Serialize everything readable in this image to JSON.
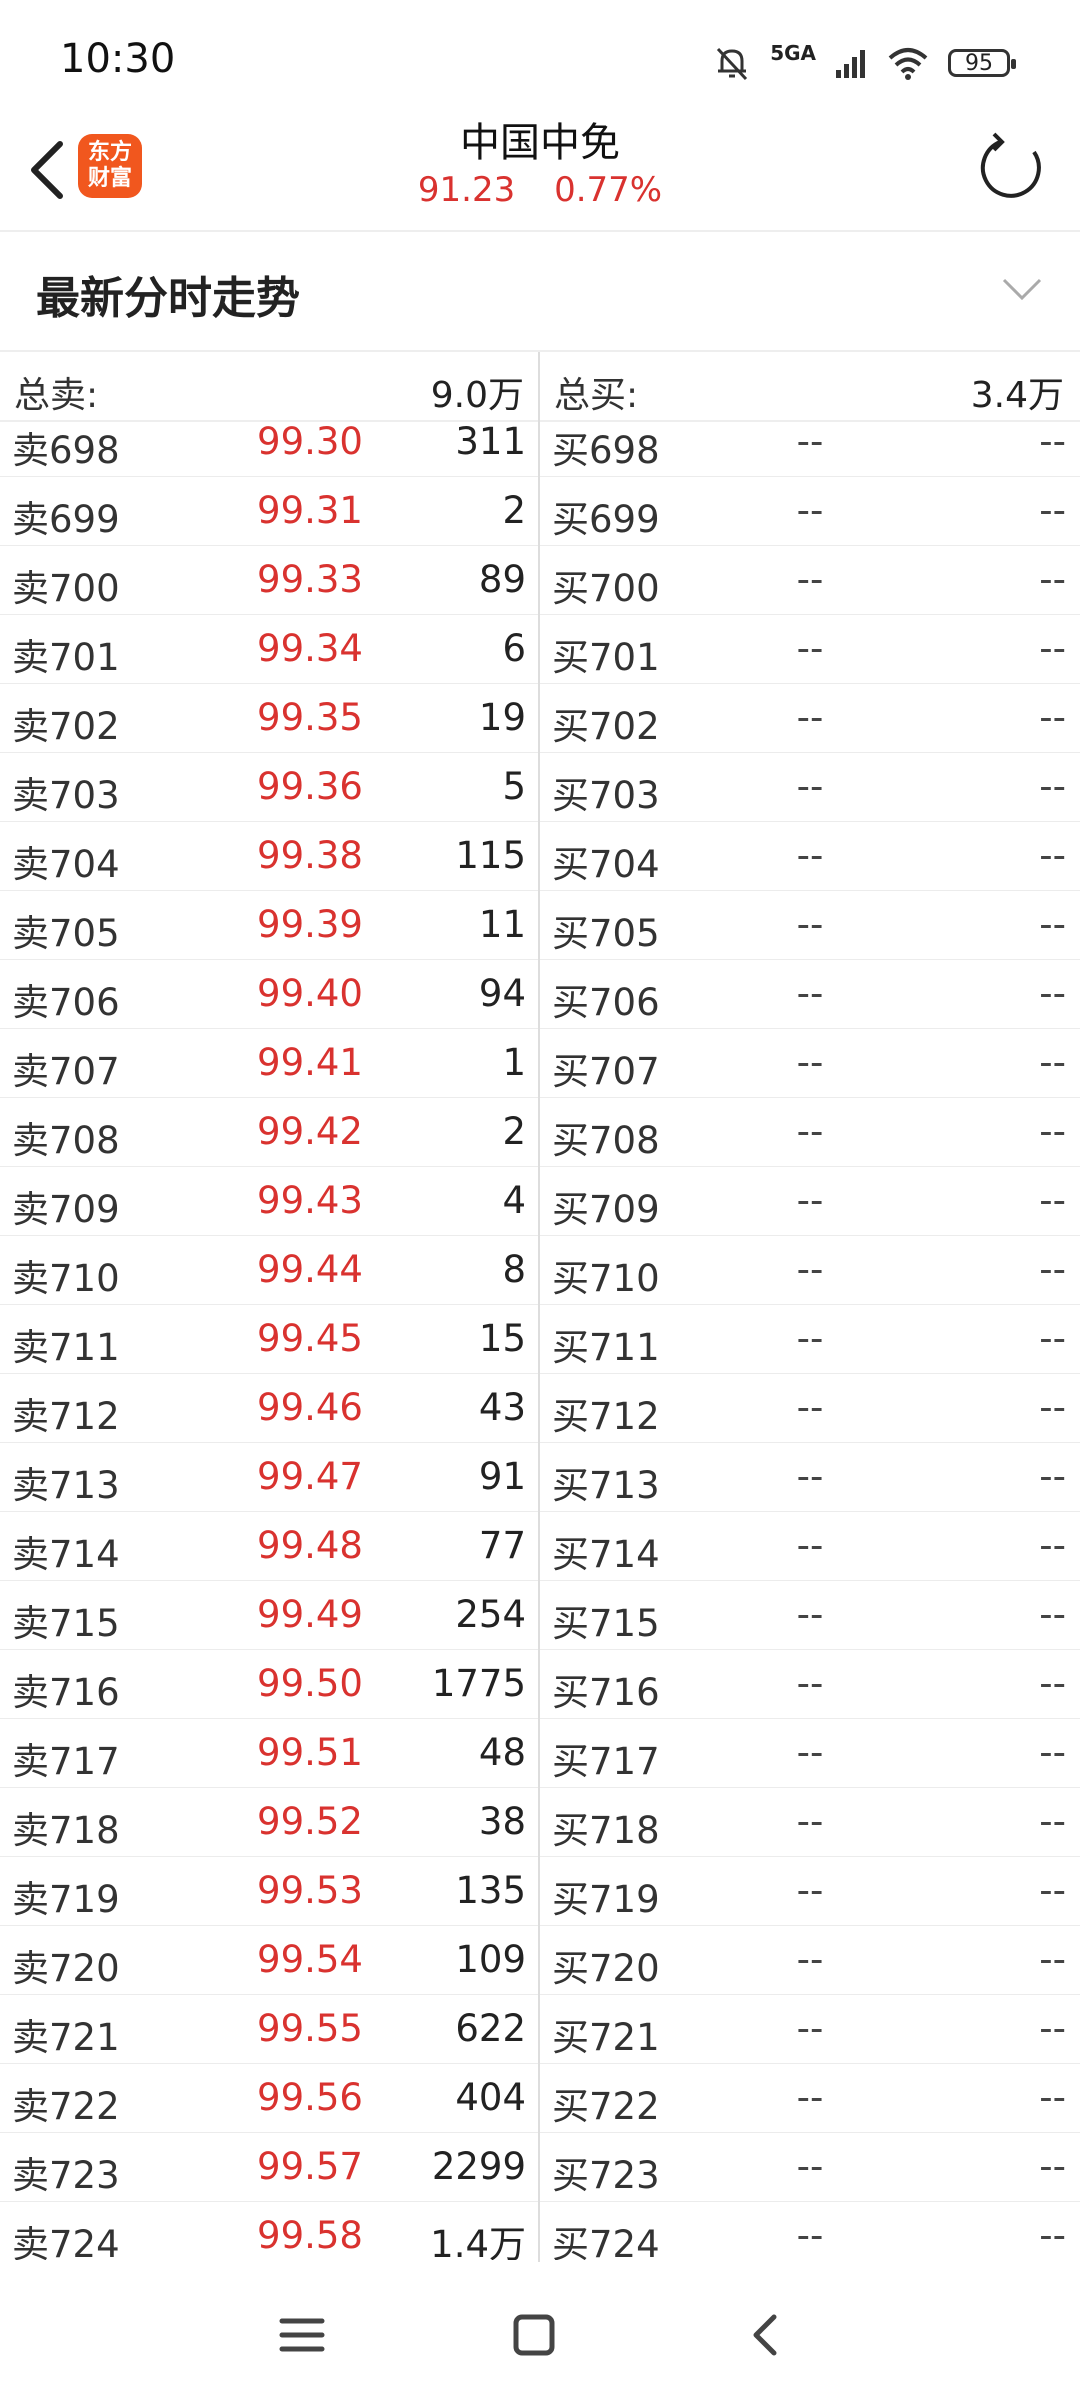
{
  "status_bar": {
    "time": "10:30",
    "network": "5GA",
    "battery": "95",
    "icons": [
      "bell-muted-icon",
      "signal-icon",
      "wifi-icon",
      "battery-icon"
    ]
  },
  "header": {
    "logo_line1": "东方",
    "logo_line2": "财富",
    "stock_name": "中国中免",
    "price": "91.23",
    "change": "0.77%"
  },
  "section": {
    "title": "最新分时走势"
  },
  "totals": {
    "sell_label": "总卖:",
    "sell_value": "9.0万",
    "buy_label": "总买:",
    "buy_value": "3.4万"
  },
  "orderbook": {
    "rows": [
      {
        "sell_label": "卖698",
        "sell_price": "99.30",
        "sell_vol": "311",
        "buy_label": "买698",
        "buy_price": "--",
        "buy_vol": "--"
      },
      {
        "sell_label": "卖699",
        "sell_price": "99.31",
        "sell_vol": "2",
        "buy_label": "买699",
        "buy_price": "--",
        "buy_vol": "--"
      },
      {
        "sell_label": "卖700",
        "sell_price": "99.33",
        "sell_vol": "89",
        "buy_label": "买700",
        "buy_price": "--",
        "buy_vol": "--"
      },
      {
        "sell_label": "卖701",
        "sell_price": "99.34",
        "sell_vol": "6",
        "buy_label": "买701",
        "buy_price": "--",
        "buy_vol": "--"
      },
      {
        "sell_label": "卖702",
        "sell_price": "99.35",
        "sell_vol": "19",
        "buy_label": "买702",
        "buy_price": "--",
        "buy_vol": "--"
      },
      {
        "sell_label": "卖703",
        "sell_price": "99.36",
        "sell_vol": "5",
        "buy_label": "买703",
        "buy_price": "--",
        "buy_vol": "--"
      },
      {
        "sell_label": "卖704",
        "sell_price": "99.38",
        "sell_vol": "115",
        "buy_label": "买704",
        "buy_price": "--",
        "buy_vol": "--"
      },
      {
        "sell_label": "卖705",
        "sell_price": "99.39",
        "sell_vol": "11",
        "buy_label": "买705",
        "buy_price": "--",
        "buy_vol": "--"
      },
      {
        "sell_label": "卖706",
        "sell_price": "99.40",
        "sell_vol": "94",
        "buy_label": "买706",
        "buy_price": "--",
        "buy_vol": "--"
      },
      {
        "sell_label": "卖707",
        "sell_price": "99.41",
        "sell_vol": "1",
        "buy_label": "买707",
        "buy_price": "--",
        "buy_vol": "--"
      },
      {
        "sell_label": "卖708",
        "sell_price": "99.42",
        "sell_vol": "2",
        "buy_label": "买708",
        "buy_price": "--",
        "buy_vol": "--"
      },
      {
        "sell_label": "卖709",
        "sell_price": "99.43",
        "sell_vol": "4",
        "buy_label": "买709",
        "buy_price": "--",
        "buy_vol": "--"
      },
      {
        "sell_label": "卖710",
        "sell_price": "99.44",
        "sell_vol": "8",
        "buy_label": "买710",
        "buy_price": "--",
        "buy_vol": "--"
      },
      {
        "sell_label": "卖711",
        "sell_price": "99.45",
        "sell_vol": "15",
        "buy_label": "买711",
        "buy_price": "--",
        "buy_vol": "--"
      },
      {
        "sell_label": "卖712",
        "sell_price": "99.46",
        "sell_vol": "43",
        "buy_label": "买712",
        "buy_price": "--",
        "buy_vol": "--"
      },
      {
        "sell_label": "卖713",
        "sell_price": "99.47",
        "sell_vol": "91",
        "buy_label": "买713",
        "buy_price": "--",
        "buy_vol": "--"
      },
      {
        "sell_label": "卖714",
        "sell_price": "99.48",
        "sell_vol": "77",
        "buy_label": "买714",
        "buy_price": "--",
        "buy_vol": "--"
      },
      {
        "sell_label": "卖715",
        "sell_price": "99.49",
        "sell_vol": "254",
        "buy_label": "买715",
        "buy_price": "--",
        "buy_vol": "--"
      },
      {
        "sell_label": "卖716",
        "sell_price": "99.50",
        "sell_vol": "1775",
        "buy_label": "买716",
        "buy_price": "--",
        "buy_vol": "--"
      },
      {
        "sell_label": "卖717",
        "sell_price": "99.51",
        "sell_vol": "48",
        "buy_label": "买717",
        "buy_price": "--",
        "buy_vol": "--"
      },
      {
        "sell_label": "卖718",
        "sell_price": "99.52",
        "sell_vol": "38",
        "buy_label": "买718",
        "buy_price": "--",
        "buy_vol": "--"
      },
      {
        "sell_label": "卖719",
        "sell_price": "99.53",
        "sell_vol": "135",
        "buy_label": "买719",
        "buy_price": "--",
        "buy_vol": "--"
      },
      {
        "sell_label": "卖720",
        "sell_price": "99.54",
        "sell_vol": "109",
        "buy_label": "买720",
        "buy_price": "--",
        "buy_vol": "--"
      },
      {
        "sell_label": "卖721",
        "sell_price": "99.55",
        "sell_vol": "622",
        "buy_label": "买721",
        "buy_price": "--",
        "buy_vol": "--"
      },
      {
        "sell_label": "卖722",
        "sell_price": "99.56",
        "sell_vol": "404",
        "buy_label": "买722",
        "buy_price": "--",
        "buy_vol": "--"
      },
      {
        "sell_label": "卖723",
        "sell_price": "99.57",
        "sell_vol": "2299",
        "buy_label": "买723",
        "buy_price": "--",
        "buy_vol": "--"
      },
      {
        "sell_label": "卖724",
        "sell_price": "99.58",
        "sell_vol": "1.4万",
        "buy_label": "买724",
        "buy_price": "--",
        "buy_vol": "--"
      }
    ]
  },
  "nav_bar": {
    "icons": [
      "menu-icon",
      "home-square-icon",
      "back-chevron-icon"
    ]
  },
  "colors": {
    "price_red": "#d9322f",
    "logo_orange": "#f1571e"
  }
}
